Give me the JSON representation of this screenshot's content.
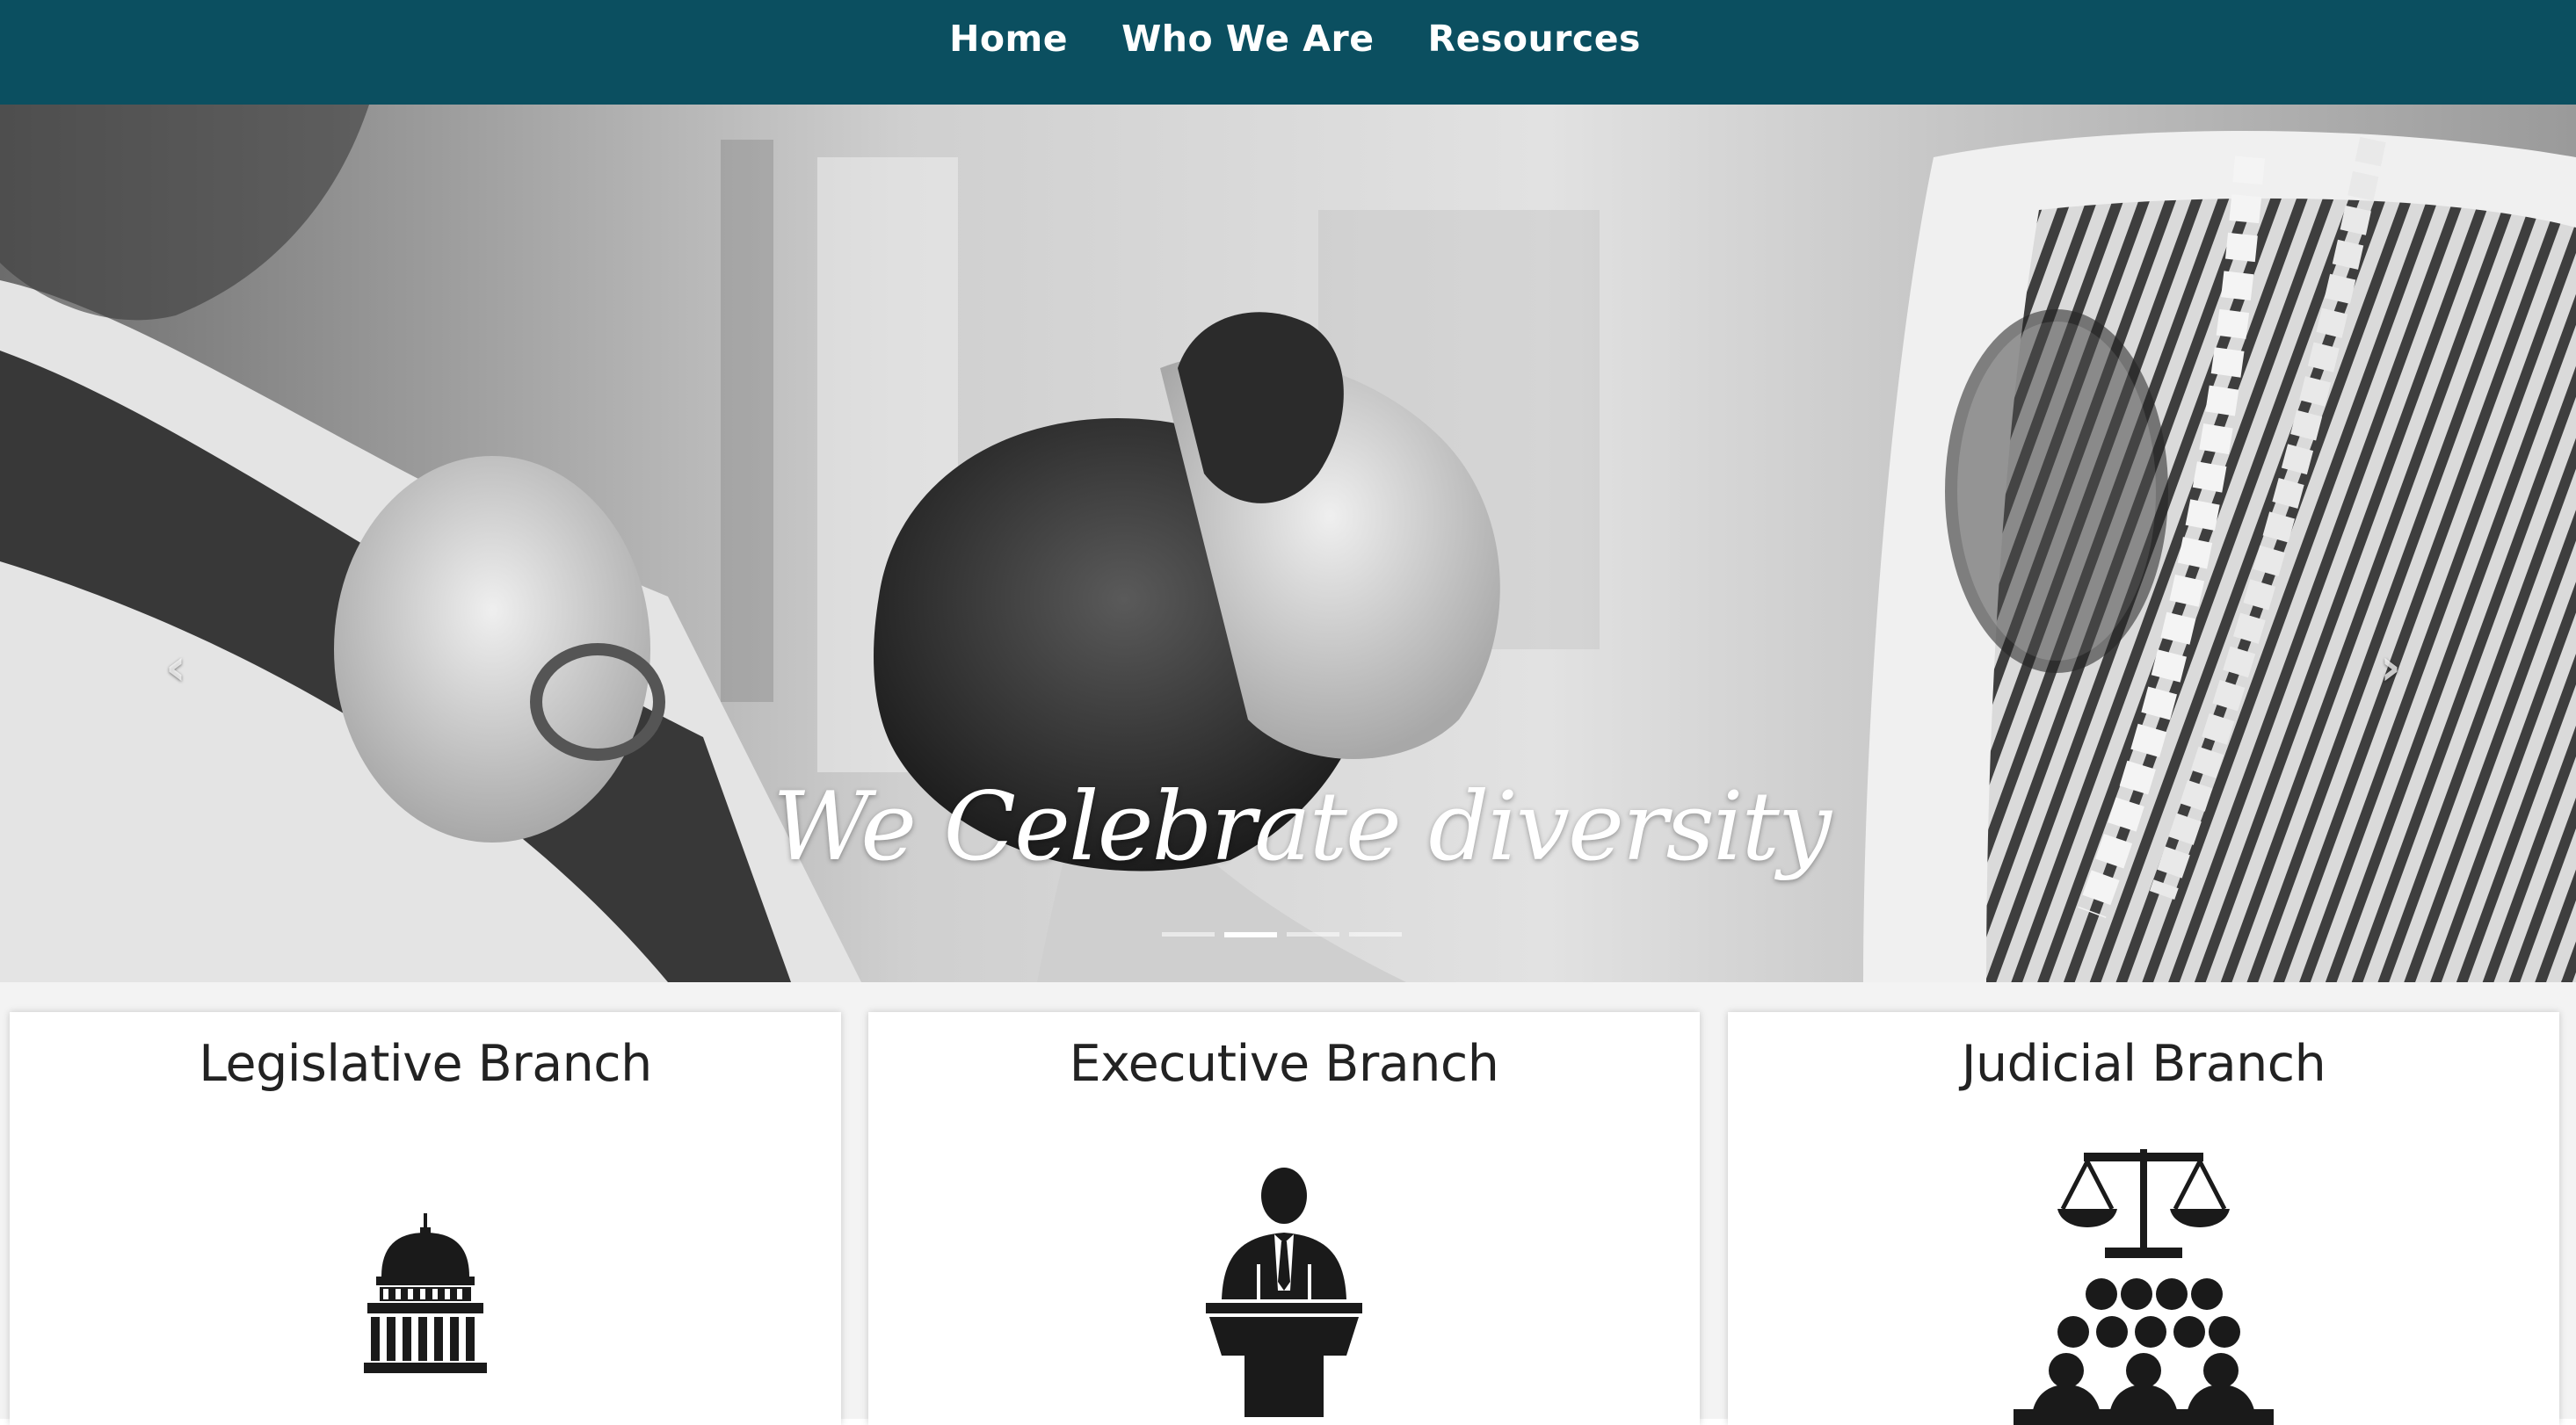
{
  "nav": {
    "items": [
      {
        "label": "Home"
      },
      {
        "label": "Who We Are"
      },
      {
        "label": "Resources"
      }
    ],
    "background": "#0b4f60"
  },
  "hero": {
    "caption": "We Celebrate diversity",
    "prev_icon": "chevron-left-icon",
    "next_icon": "chevron-right-icon",
    "prev_glyph": "‹",
    "next_glyph": "›",
    "slide_count": 4,
    "active_slide": 2
  },
  "cards": [
    {
      "title": "Legislative Branch",
      "icon": "capitol-building-icon"
    },
    {
      "title": "Executive Branch",
      "icon": "speaker-at-podium-icon"
    },
    {
      "title": "Judicial Branch",
      "icon": "scales-of-justice-jury-icon"
    }
  ]
}
